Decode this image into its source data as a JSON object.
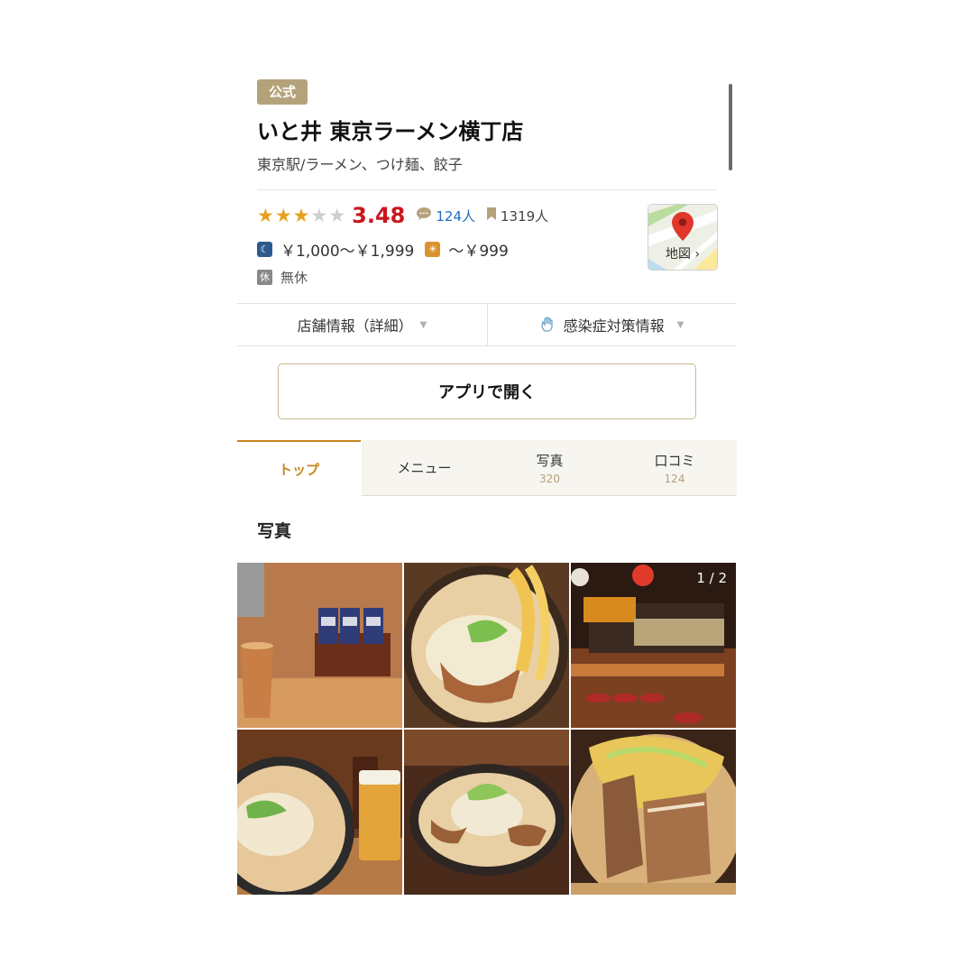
{
  "shop": {
    "badge": "公式",
    "name": "いと井 東京ラーメン横丁店",
    "area_genre": "東京駅/ラーメン、つけ麺、餃子"
  },
  "rating": {
    "stars": 3.48,
    "score": "3.48",
    "reviews_count": "124人",
    "saved_count": "1319人"
  },
  "price": {
    "dinner": "￥1,000～￥1,999",
    "lunch": "～￥999"
  },
  "holiday": {
    "icon_label": "休",
    "value": "無休"
  },
  "map_button": {
    "label": "地図 ›"
  },
  "info_tabs": {
    "details": "店舗情報（詳細）",
    "covid": "感染症対策情報"
  },
  "open_app_button": "アプリで開く",
  "tabs": [
    {
      "label": "トップ",
      "count": ""
    },
    {
      "label": "メニュー",
      "count": ""
    },
    {
      "label": "写真",
      "count": "320"
    },
    {
      "label": "口コミ",
      "count": "124"
    }
  ],
  "photos_section": {
    "title": "写真",
    "pager": "1 / 2"
  },
  "colors": {
    "accent": "#c8861e",
    "badge": "#b4a27b",
    "score_red": "#c9171e",
    "link_blue": "#1e6ec0"
  },
  "icons": [
    "star-icon",
    "comment-icon",
    "bookmark-icon",
    "moon-icon",
    "sun-icon",
    "holiday-icon",
    "map-pin-icon",
    "hand-icon",
    "caret-down-icon"
  ]
}
